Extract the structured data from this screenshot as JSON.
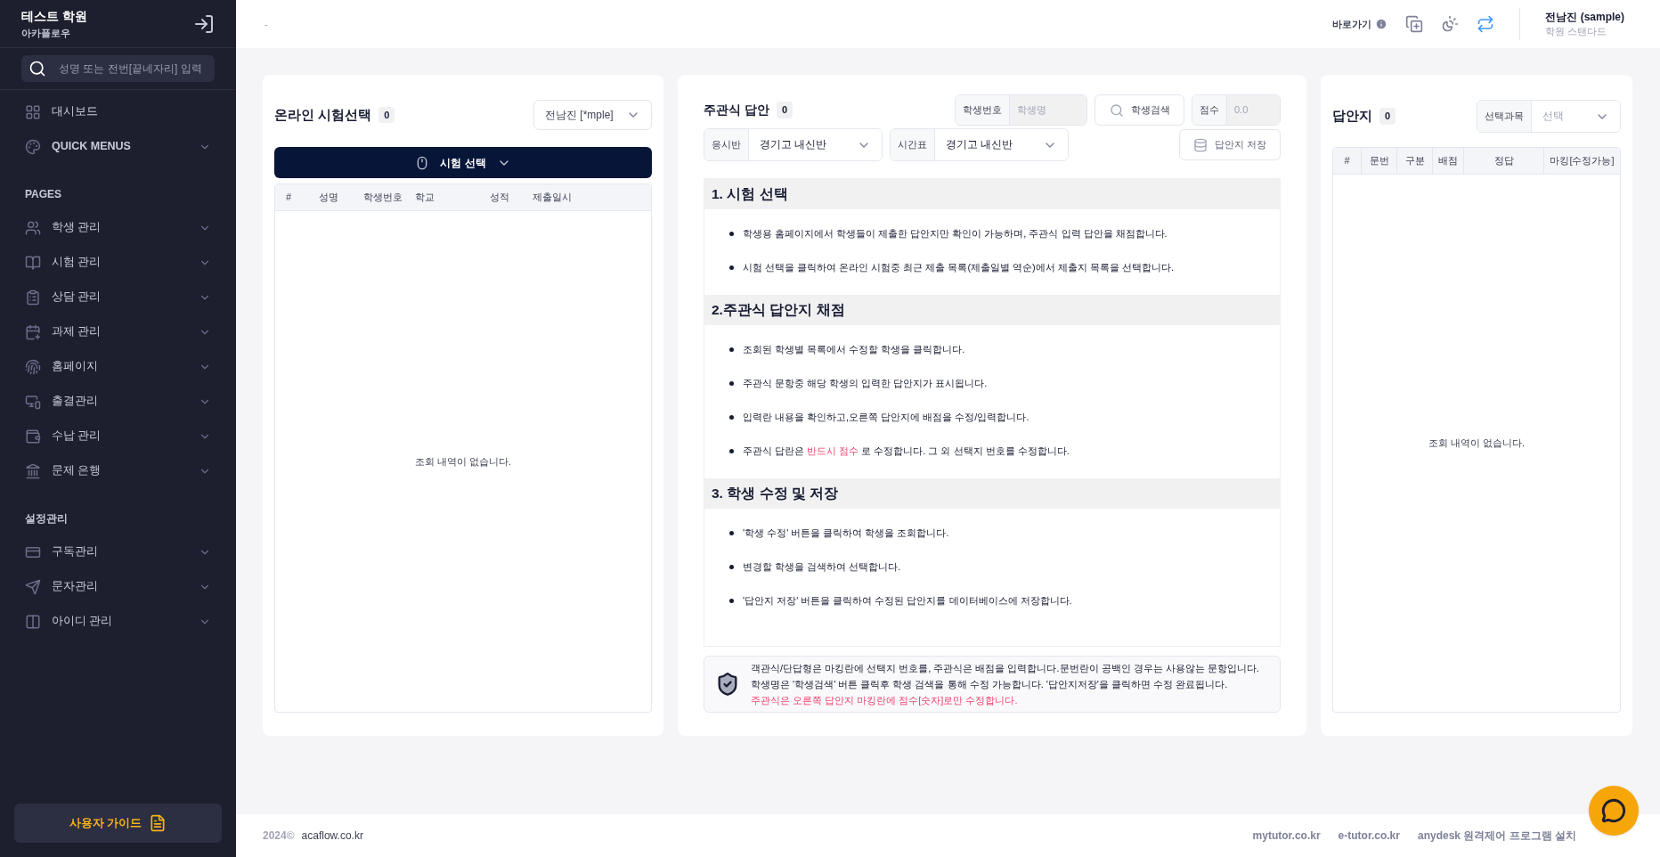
{
  "sidebar": {
    "brand": {
      "title": "테스트 학원",
      "subtitle": "아카플로우"
    },
    "search": {
      "placeholder": "성명 또는 전번[끝네자리] 입력"
    },
    "sections": [
      {
        "items": [
          {
            "label": "대시보드",
            "kind": "link"
          },
          {
            "label": "QUICK MENUS",
            "kind": "group",
            "expanded": false
          }
        ]
      },
      {
        "title": "PAGES",
        "items": [
          {
            "label": "학생 관리",
            "kind": "menu",
            "expanded": false
          },
          {
            "label": "시험 관리",
            "kind": "menu",
            "expanded": false
          },
          {
            "label": "상담 관리",
            "kind": "menu",
            "expanded": false
          },
          {
            "label": "과제 관리",
            "kind": "menu",
            "expanded": false
          },
          {
            "label": "홈페이지",
            "kind": "menu",
            "expanded": false
          },
          {
            "label": "출결관리",
            "kind": "menu",
            "expanded": false
          },
          {
            "label": "수납 관리",
            "kind": "menu",
            "expanded": false
          },
          {
            "label": "문제 은행",
            "kind": "menu",
            "expanded": false
          }
        ]
      },
      {
        "title": "설정관리",
        "items": [
          {
            "label": "구독관리",
            "kind": "menu",
            "expanded": false
          },
          {
            "label": "문자관리",
            "kind": "menu",
            "expanded": false
          },
          {
            "label": "아이디 관리",
            "kind": "menu",
            "expanded": false
          }
        ]
      }
    ],
    "guide_button": "사용자 가이드"
  },
  "header": {
    "breadcrumb": "-",
    "shortcut": "바로가기",
    "user": {
      "name": "전남진 (sample)",
      "plan": "학원 스탠다드"
    }
  },
  "exam_panel": {
    "title": "온라인 시험선택",
    "count": "0",
    "teacher_select": "전남진 [*mple]",
    "select_button": "시험 선택",
    "table": {
      "columns": [
        "#",
        "성명",
        "학생번호",
        "학교",
        "성적",
        "제출일시"
      ],
      "empty": "조회 내역이 없습니다."
    }
  },
  "answer_panel": {
    "title": "주관식 답안",
    "count": "0",
    "student": {
      "label": "학생번호",
      "placeholder": "학생명"
    },
    "search_button": "학생검색",
    "score": {
      "label": "점수",
      "placeholder": "0.0"
    },
    "class_select": {
      "label": "응시반",
      "value": "경기고 내신반"
    },
    "schedule_select": {
      "label": "시간표",
      "value": "경기고 내신반"
    },
    "save_button": "답안지 저장",
    "guide": [
      {
        "heading": "1. 시험 선택",
        "bullets": [
          [
            {
              "text": "학생용 홈페이지에서 학생들이 제출한 답안지만 확인이 가능하며, 주관식 입력 답안을 채점합니다.",
              "highlight": false
            }
          ],
          [
            {
              "text": "시험 선택을 클릭하여 온라인 시험중 최근 제출 목록(제출일별 역순)에서 제출지 목록을 선택합니다.",
              "highlight": false
            }
          ]
        ]
      },
      {
        "heading": "2.주관식 답안지 채점",
        "bullets": [
          [
            {
              "text": "조회된 학생별 목록에서 수정할 학생을 클릭합니다.",
              "highlight": false
            }
          ],
          [
            {
              "text": "주관식 문항중 해당 학생의 입력한 답안지가 표시됩니다.",
              "highlight": false
            }
          ],
          [
            {
              "text": "입력란 내용을 확인하고,오른쪽 답안지에 배점을 수정/입력합니다.",
              "highlight": false
            }
          ],
          [
            {
              "text": "주관식 답란은 ",
              "highlight": false
            },
            {
              "text": "반드시 점수",
              "highlight": true
            },
            {
              "text": " 로 수정합니다. 그 외 선택지 번호를 수정합니다.",
              "highlight": false
            }
          ]
        ]
      },
      {
        "heading": "3. 학생 수정 및 저장",
        "bullets": [
          [
            {
              "text": "'학생 수정' 버튼을 클릭하여 학생을 조회합니다.",
              "highlight": false
            }
          ],
          [
            {
              "text": "변경할 학생을 검색하여 선택합니다.",
              "highlight": false
            }
          ],
          [
            {
              "text": "'답안지 저장' 버튼을 클릭하여 수정된 답안지를 데이터베이스에 저장합니다.",
              "highlight": false
            }
          ]
        ]
      }
    ],
    "notice": [
      {
        "text": "객관식/단답형은 마킹란에 선택지 번호를, 주관식은 배점을 입력합니다.문번란이 공백인 경우는 사용않는 문항입니다.",
        "kind": "normal"
      },
      {
        "text": "학생명은 '학생검색' 버튼 클릭후 학생 검색을 통해 수정 가능합니다. '답안지저장'을 클릭하면 수정 완료됩니다.",
        "kind": "normal"
      },
      {
        "text": "주관식은 오른쪽 답안지 마킹란에 점수[숫자]로만 수정합니다.",
        "kind": "warning"
      }
    ]
  },
  "sheet_panel": {
    "title": "답안지",
    "count": "0",
    "subject": {
      "label": "선택과목",
      "placeholder": "선택"
    },
    "table": {
      "columns": [
        "#",
        "문번",
        "구분",
        "배점",
        "정답",
        "마킹[수정가능]"
      ],
      "empty": "조회 내역이 없습니다."
    }
  },
  "footer": {
    "copyright": "2024©",
    "site": "acaflow.co.kr",
    "links": [
      "mytutor.co.kr",
      "e-tutor.co.kr",
      "anydesk 원격제어 프로그램 설치"
    ]
  }
}
